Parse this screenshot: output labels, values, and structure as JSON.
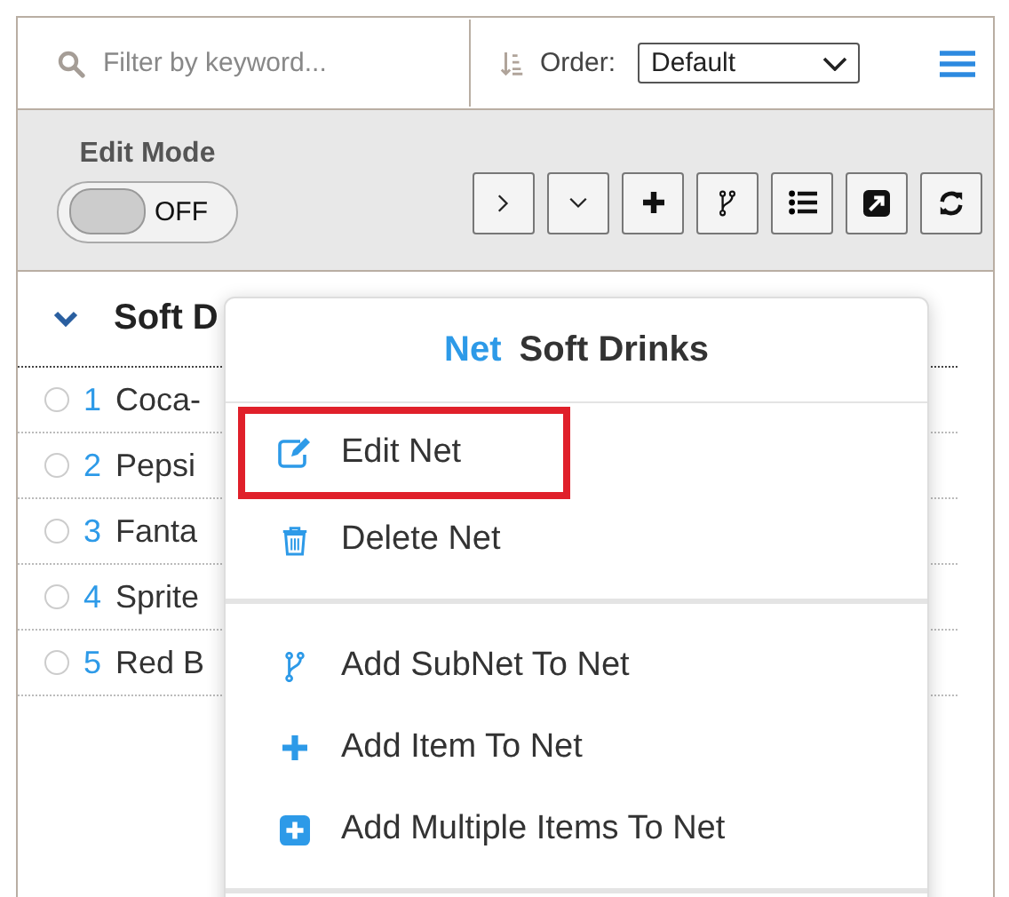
{
  "search": {
    "placeholder": "Filter by keyword..."
  },
  "order": {
    "label": "Order:",
    "value": "Default"
  },
  "edit_mode": {
    "label": "Edit Mode",
    "on": false,
    "state_text": "OFF"
  },
  "toolbar": [
    {
      "kind": "expand"
    },
    {
      "kind": "collapse"
    },
    {
      "kind": "add"
    },
    {
      "kind": "branch"
    },
    {
      "kind": "list"
    },
    {
      "kind": "open"
    },
    {
      "kind": "refresh"
    }
  ],
  "net": {
    "title": "Soft D",
    "expanded": true
  },
  "items": [
    {
      "number": "1",
      "name": "Coca-",
      "selected": false
    },
    {
      "number": "2",
      "name": "Pepsi",
      "selected": false
    },
    {
      "number": "3",
      "name": "Fanta",
      "selected": false
    },
    {
      "number": "4",
      "name": "Sprite",
      "selected": false
    },
    {
      "number": "5",
      "name": "Red B",
      "selected": false
    }
  ],
  "context_menu": {
    "type_label": "Net",
    "title": "Soft Drinks",
    "sections": [
      [
        {
          "kind": "edit",
          "label": "Edit Net",
          "highlighted": true
        },
        {
          "kind": "delete",
          "label": "Delete Net",
          "highlighted": false
        }
      ],
      [
        {
          "kind": "branch",
          "label": "Add SubNet To Net",
          "highlighted": false
        },
        {
          "kind": "add",
          "label": "Add Item To Net",
          "highlighted": false
        },
        {
          "kind": "add-multiple",
          "label": "Add Multiple Items To Net",
          "highlighted": false
        }
      ]
    ]
  }
}
